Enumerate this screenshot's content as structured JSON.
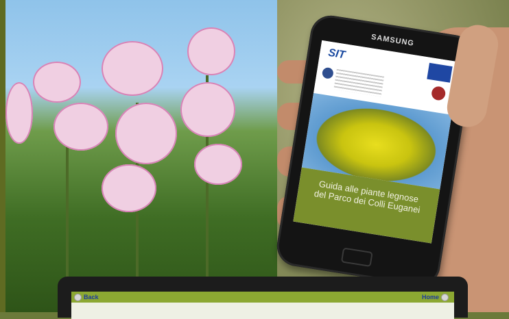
{
  "phone": {
    "brand": "SAMSUNG",
    "app_title_line1": "Guida alle piante legnose",
    "app_title_line2": "del Parco dei Colli Euganei"
  },
  "laptop": {
    "back_label": "Back",
    "home_label": "Home"
  },
  "colors": {
    "accent_green": "#8ca832",
    "link_blue": "#1e3c9c"
  },
  "icons": [
    "back-icon",
    "home-icon"
  ]
}
